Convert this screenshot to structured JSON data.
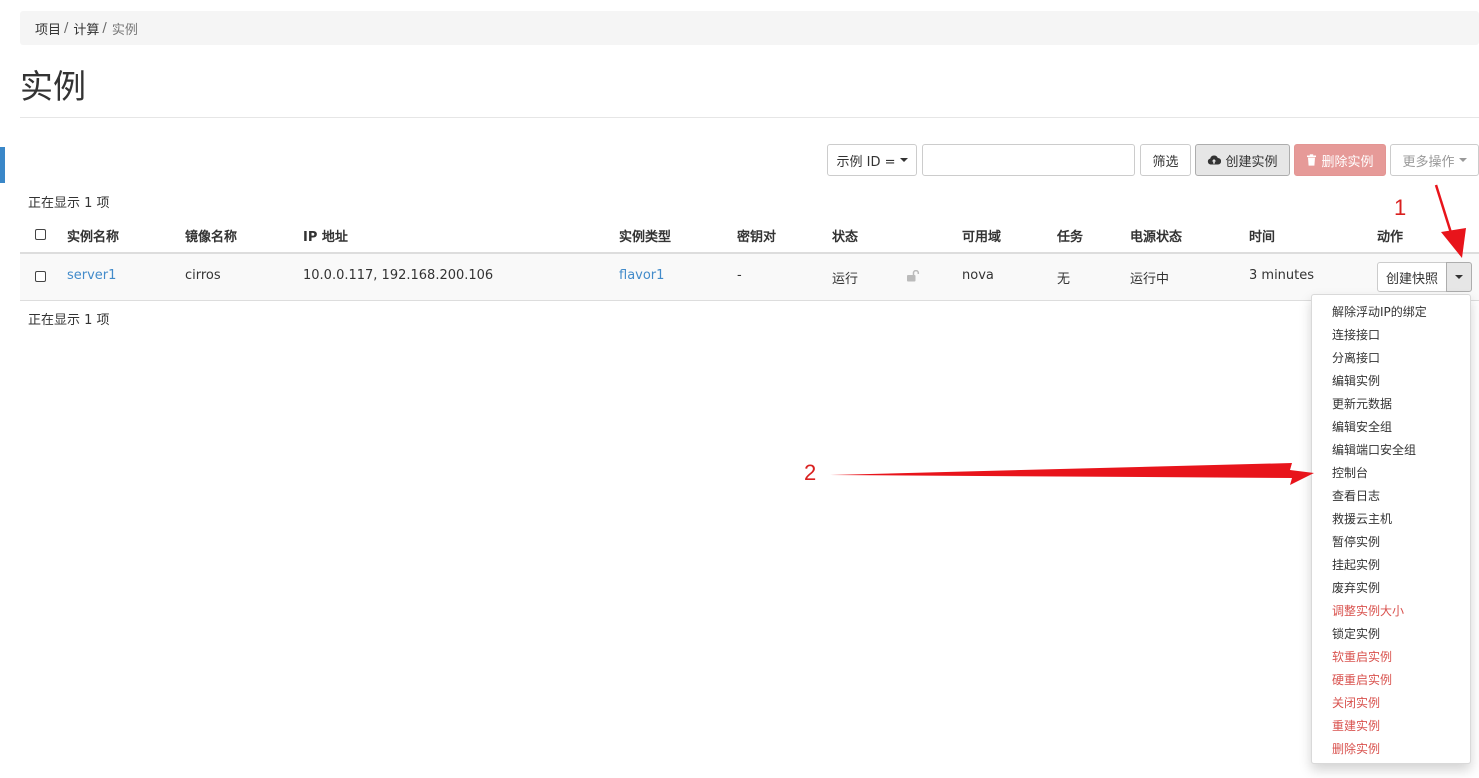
{
  "breadcrumb": [
    "项目",
    "计算",
    "实例"
  ],
  "page_title": "实例",
  "toolbar": {
    "filter_select": "示例 ID =",
    "filter_input_value": "",
    "filter_button": "筛选",
    "create_button": "创建实例",
    "delete_button": "删除实例",
    "more_button": "更多操作"
  },
  "count_text": "正在显示 1 项",
  "table": {
    "headers": [
      "实例名称",
      "镜像名称",
      "IP 地址",
      "实例类型",
      "密钥对",
      "状态",
      "可用域",
      "任务",
      "电源状态",
      "时间",
      "动作"
    ],
    "rows": [
      {
        "name": "server1",
        "image": "cirros",
        "ip": "10.0.0.117, 192.168.200.106",
        "flavor": "flavor1",
        "keypair": "-",
        "status": "运行",
        "zone": "nova",
        "task": "无",
        "power": "运行中",
        "time": "3 minutes",
        "action": "创建快照"
      }
    ]
  },
  "dropdown_items": [
    {
      "label": "解除浮动IP的绑定",
      "danger": true
    },
    {
      "label": "连接接口",
      "danger": false
    },
    {
      "label": "分离接口",
      "danger": false
    },
    {
      "label": "编辑实例",
      "danger": false
    },
    {
      "label": "更新元数据",
      "danger": false
    },
    {
      "label": "编辑安全组",
      "danger": false
    },
    {
      "label": "编辑端口安全组",
      "danger": false
    },
    {
      "label": "控制台",
      "danger": false
    },
    {
      "label": "查看日志",
      "danger": false
    },
    {
      "label": "救援云主机",
      "danger": false
    },
    {
      "label": "暂停实例",
      "danger": false
    },
    {
      "label": "挂起实例",
      "danger": false
    },
    {
      "label": "废弃实例",
      "danger": false
    },
    {
      "label": "调整实例大小",
      "danger": true
    },
    {
      "label": "锁定实例",
      "danger": false
    },
    {
      "label": "软重启实例",
      "danger": true
    },
    {
      "label": "硬重启实例",
      "danger": true
    },
    {
      "label": "关闭实例",
      "danger": true
    },
    {
      "label": "重建实例",
      "danger": true
    },
    {
      "label": "删除实例",
      "danger": true
    }
  ],
  "annotations": [
    "1",
    "2"
  ],
  "colors": {
    "link": "#428bca",
    "danger": "#d9534f",
    "delete_button_bg": "#e69a98",
    "annotation_red": "#e8141b",
    "left_marker": "#3a87c8"
  },
  "icons": [
    "cloud-upload-icon",
    "trash-icon",
    "caret-down-icon",
    "lock-open-icon"
  ]
}
